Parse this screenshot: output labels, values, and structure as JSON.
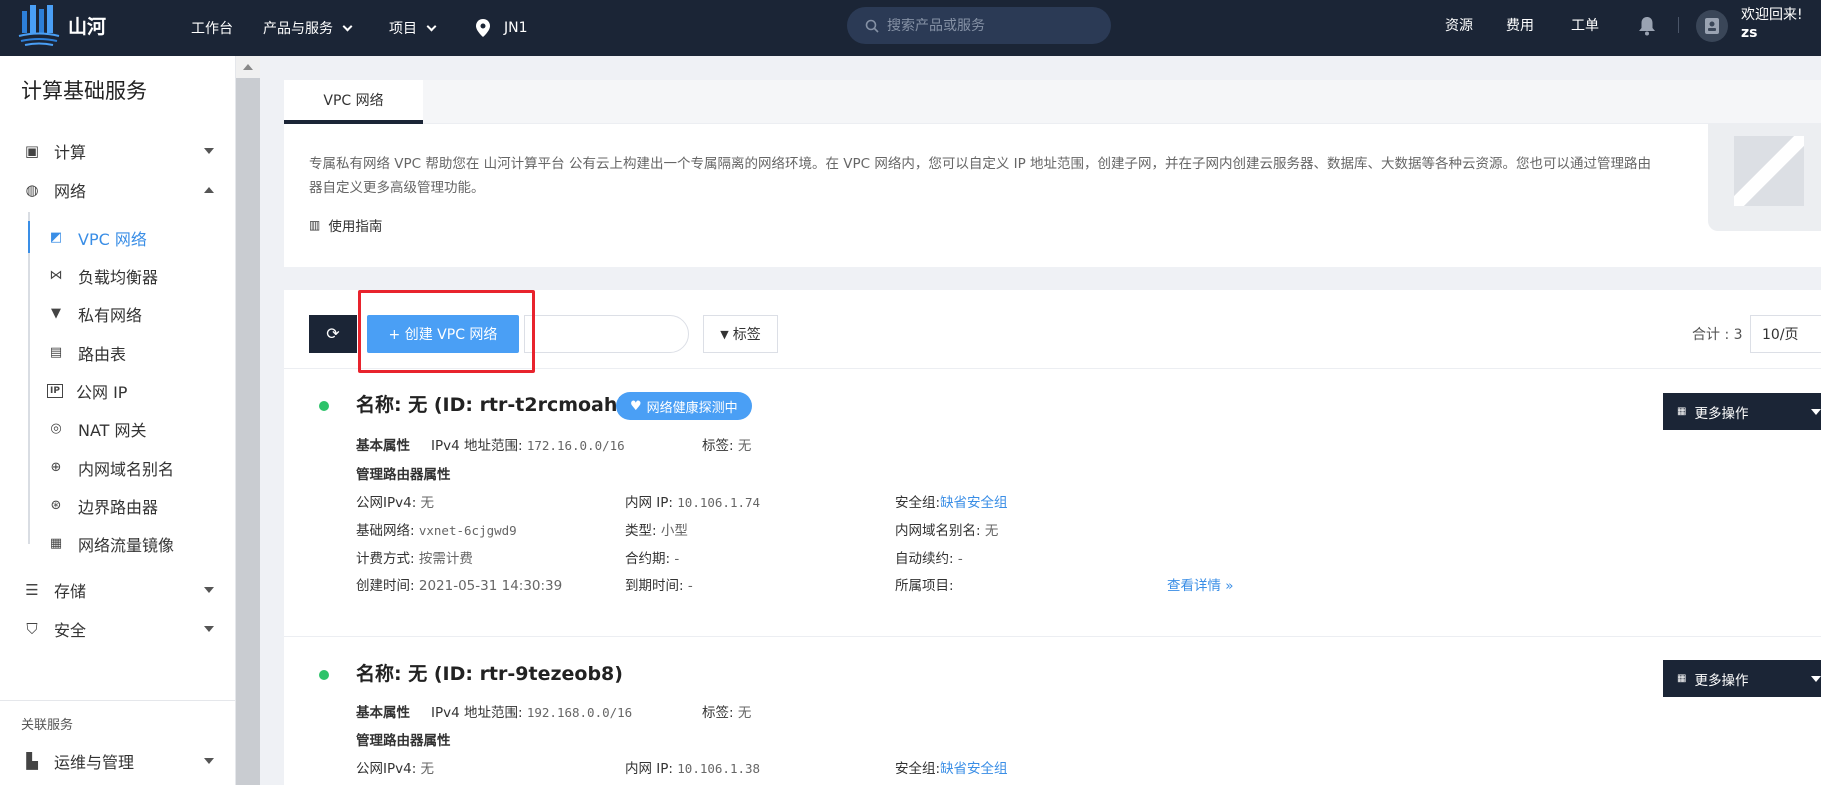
{
  "header": {
    "logo_text": "山河",
    "nav": [
      "工作台",
      "产品与服务",
      "项目"
    ],
    "region": "JN1",
    "search_placeholder": "搜索产品或服务",
    "links": [
      "资源",
      "费用",
      "工单"
    ],
    "welcome": "欢迎回来!",
    "username": "zs"
  },
  "sidebar": {
    "title": "计算基础服务",
    "groups": [
      {
        "label": "计算",
        "icon": "chip-icon"
      },
      {
        "label": "网络",
        "icon": "globe-icon"
      }
    ],
    "network_items": [
      {
        "label": "VPC 网络",
        "icon": "vpc-icon",
        "active": true
      },
      {
        "label": "负载均衡器",
        "icon": "load-balancer-icon"
      },
      {
        "label": "私有网络",
        "icon": "wifi-icon"
      },
      {
        "label": "路由表",
        "icon": "route-table-icon"
      },
      {
        "label": "公网 IP",
        "icon": "ip-icon"
      },
      {
        "label": "NAT 网关",
        "icon": "nat-icon"
      },
      {
        "label": "内网域名别名",
        "icon": "dns-icon"
      },
      {
        "label": "边界路由器",
        "icon": "border-router-icon"
      },
      {
        "label": "网络流量镜像",
        "icon": "traffic-mirror-icon"
      }
    ],
    "more_groups": [
      {
        "label": "存储",
        "icon": "storage-icon"
      },
      {
        "label": "安全",
        "icon": "shield-icon"
      }
    ],
    "related_title": "关联服务",
    "related_items": [
      {
        "label": "运维与管理",
        "icon": "ops-icon"
      }
    ]
  },
  "intro": {
    "tab": "VPC 网络",
    "description": "专属私有网络 VPC 帮助您在 山河计算平台 公有云上构建出一个专属隔离的网络环境。在 VPC 网络内，您可以自定义 IP 地址范围，创建子网，并在子网内创建云服务器、数据库、大数据等各种云资源。您也可以通过管理路由器自定义更多高级管理功能。",
    "guide": "使用指南"
  },
  "toolbar": {
    "create_label": "+ 创建 VPC 网络",
    "tag_label": "标签",
    "total_label": "合计 : 3",
    "page_size": "10/页"
  },
  "labels": {
    "basic": "基本属性",
    "ipv4_range": "IPv4 地址范围:",
    "tag": "标签:",
    "router_props": "管理路由器属性",
    "public_ipv4": "公网IPv4:",
    "private_ip": "内网 IP:",
    "security_group": "安全组:",
    "base_net": "基础网络:",
    "type": "类型:",
    "dns_alias": "内网域名别名:",
    "billing": "计费方式:",
    "contract": "合约期:",
    "auto_renew": "自动续约:",
    "created": "创建时间:",
    "expire": "到期时间:",
    "project": "所属项目:",
    "details": "查看详情 »",
    "more_ops": "更多操作"
  },
  "vpcs": [
    {
      "title": "名称: 无 (ID: rtr-t2rcmoah)",
      "badge": "网络健康探测中",
      "ipv4_range": "172.16.0.0/16",
      "tag": "无",
      "public_ipv4": "无",
      "private_ip": "10.106.1.74",
      "security_group": "缺省安全组",
      "base_net": "vxnet-6cjgwd9",
      "type": "小型",
      "dns_alias": "无",
      "billing": "按需计费",
      "contract": "-",
      "auto_renew": "-",
      "created": "2021-05-31 14:30:39",
      "expire": "-",
      "project": ""
    },
    {
      "title": "名称: 无 (ID: rtr-9tezeob8)",
      "ipv4_range": "192.168.0.0/16",
      "tag": "无",
      "public_ipv4": "无",
      "private_ip": "10.106.1.38",
      "security_group": "缺省安全组"
    }
  ]
}
